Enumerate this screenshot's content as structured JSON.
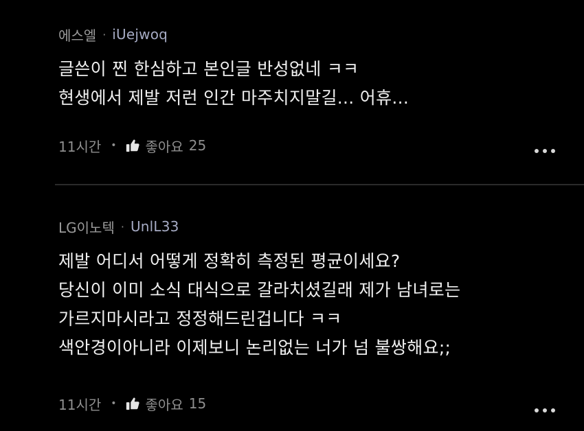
{
  "comments": [
    {
      "author": "에스엘",
      "separator": "·",
      "handle": "iUejwoq",
      "lines": [
        "글쓴이 찐 한심하고 본인글 반성없네 ㅋㅋ",
        "현생에서 제발 저런 인간 마주치지말길... 어휴..."
      ],
      "time": "11시간",
      "dot": "•",
      "like_label": "좋아요",
      "like_count": "25",
      "icons": {
        "like": "thumbs-up-icon",
        "more": "more-options-icon"
      }
    },
    {
      "author": "LG이노텍",
      "separator": "·",
      "handle": "UnlL33",
      "lines": [
        "제발 어디서 어떻게 정확히 측정된 평균이세요?",
        "당신이 이미 소식 대식으로 갈라치셨길래 제가 남녀로는",
        "가르지마시라고 정정해드린겁니다 ㅋㅋ",
        "색안경이아니라 이제보니 논리없는 너가 넘 불쌍해요;;"
      ],
      "time": "11시간",
      "dot": "•",
      "like_label": "좋아요",
      "like_count": "15",
      "icons": {
        "like": "thumbs-up-icon",
        "more": "more-options-icon"
      }
    }
  ],
  "colors": {
    "background": "#000000",
    "text": "#efefef",
    "muted": "#9a9a9a",
    "handle": "#a6abc4",
    "divider": "#2a2a2a"
  }
}
